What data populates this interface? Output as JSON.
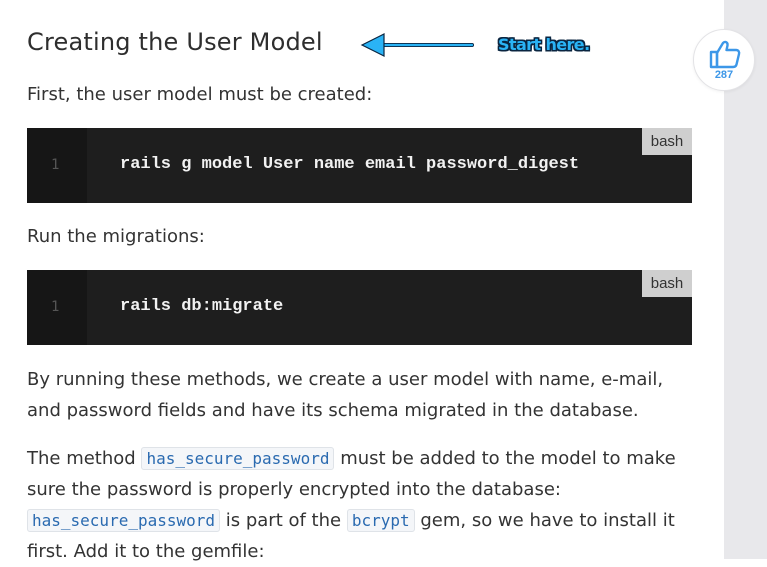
{
  "article": {
    "heading": "Creating the User Model",
    "annotation": "Start here.",
    "intro": "First, the user model must be created:",
    "code_blocks": [
      {
        "line_number": "1",
        "code": "rails g model User name email password_digest",
        "lang": "bash"
      },
      {
        "line_number": "1",
        "code": "rails db:migrate",
        "lang": "bash"
      }
    ],
    "run_migrations": "Run the migrations:",
    "para_schema": "By running these methods, we create a user model with name, e-mail, and password fields and have its schema migrated in the database.",
    "para_method": {
      "text1": "The method ",
      "code1": "has_secure_password",
      "text2": " must be added to the model to make sure the password is properly encrypted into the database: ",
      "code2": "has_secure_password",
      "text3": " is part of the ",
      "code3": "bcrypt",
      "text4": " gem, so we have to install it first. Add it to the gemfile:"
    }
  },
  "like": {
    "icon": "thumbs-up-icon",
    "count": "287",
    "color": "#3c97e8"
  },
  "colors": {
    "annotation_arrow": "#2ab3f5",
    "code_bg": "#1e1e1e",
    "inline_code": "#2a6ab0"
  }
}
